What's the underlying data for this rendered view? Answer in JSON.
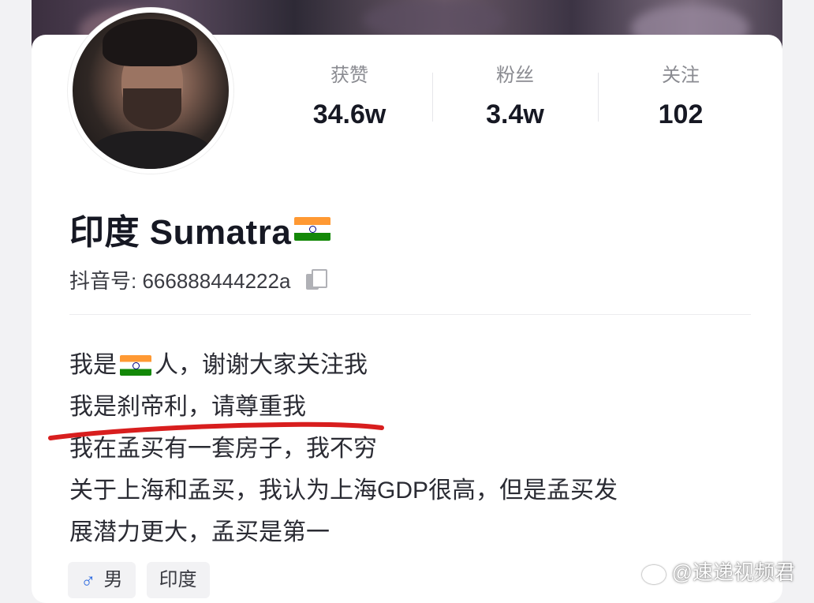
{
  "profile": {
    "name": "印度 Sumatra",
    "flag_icon": "india-flag",
    "douyin_id": "抖音号: 666888444222a"
  },
  "stats": [
    {
      "label": "获赞",
      "value": "34.6w"
    },
    {
      "label": "粉丝",
      "value": "3.4w"
    },
    {
      "label": "关注",
      "value": "102"
    }
  ],
  "bio": {
    "line1_a": "我是",
    "line1_b": "人，谢谢大家关注我",
    "line2": "我是刹帝利，请尊重我",
    "line3": "我在孟买有一套房子，我不穷",
    "line4": "关于上海和孟买，我认为上海GDP很高，但是孟买发",
    "line5": "展潜力更大，孟买是第一"
  },
  "tags": {
    "gender_icon": "male-icon",
    "gender": "男",
    "location": "印度"
  },
  "watermark": "@速递视频君",
  "colors": {
    "underline": "#d81e1e",
    "male": "#2f6be0"
  }
}
